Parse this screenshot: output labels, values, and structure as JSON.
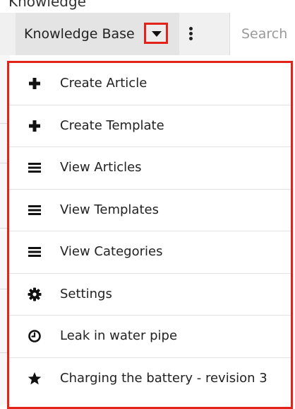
{
  "header": {
    "partial_label": "Knowledge",
    "module_tab_label": "Knowledge Base",
    "search_placeholder": "Search",
    "highlight_color": "#e2231a"
  },
  "menu": {
    "items": [
      {
        "label": "Create Article",
        "icon": "plus-icon"
      },
      {
        "label": "Create Template",
        "icon": "plus-icon"
      },
      {
        "label": "View Articles",
        "icon": "list-icon"
      },
      {
        "label": "View Templates",
        "icon": "list-icon"
      },
      {
        "label": "View Categories",
        "icon": "list-icon"
      },
      {
        "label": "Settings",
        "icon": "gear-icon"
      },
      {
        "label": "Leak in water pipe",
        "icon": "clock-icon"
      },
      {
        "label": "Charging the battery - revision 3",
        "icon": "star-icon"
      }
    ]
  }
}
